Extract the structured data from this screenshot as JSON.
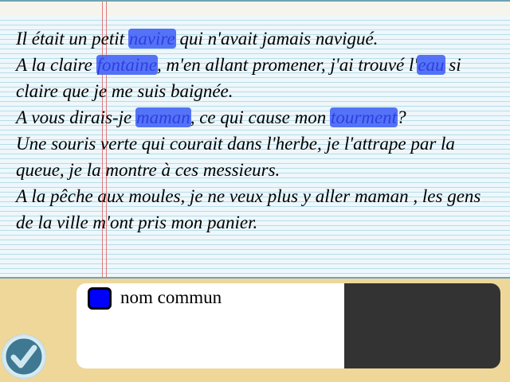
{
  "sentences": [
    {
      "parts": [
        {
          "text": "Il était un petit ",
          "hl": false
        },
        {
          "text": "navire",
          "hl": true
        },
        {
          "text": " qui n'avait jamais navigué.",
          "hl": false
        }
      ]
    },
    {
      "parts": [
        {
          "text": "A la claire ",
          "hl": false
        },
        {
          "text": "fontaine",
          "hl": true
        },
        {
          "text": ", m'en allant promener, j'ai trouvé l'",
          "hl": false
        },
        {
          "text": "eau",
          "hl": true
        },
        {
          "text": " si claire que je me suis baignée.",
          "hl": false
        }
      ]
    },
    {
      "parts": [
        {
          "text": "A vous dirais-je ",
          "hl": false
        },
        {
          "text": "maman",
          "hl": true
        },
        {
          "text": ", ce qui cause mon ",
          "hl": false
        },
        {
          "text": "tourment",
          "hl": true
        },
        {
          "text": "?",
          "hl": false
        }
      ]
    },
    {
      "parts": [
        {
          "text": "Une souris verte qui courait dans l'herbe, je l'attrape par la queue, je la montre à ces messieurs.",
          "hl": false
        }
      ]
    },
    {
      "parts": [
        {
          "text": "A la pêche aux moules, je ne veux plus y aller maman , les gens de la ville m'ont pris mon panier.",
          "hl": false
        }
      ]
    }
  ],
  "legend": {
    "label": "nom commun",
    "color": "#0000ff"
  },
  "colors": {
    "highlight": "#4c6cf7",
    "paper": "#eef7fb",
    "desk": "#efd79a",
    "panel_dark": "#333333"
  },
  "icons": {
    "validate": "check-icon"
  }
}
